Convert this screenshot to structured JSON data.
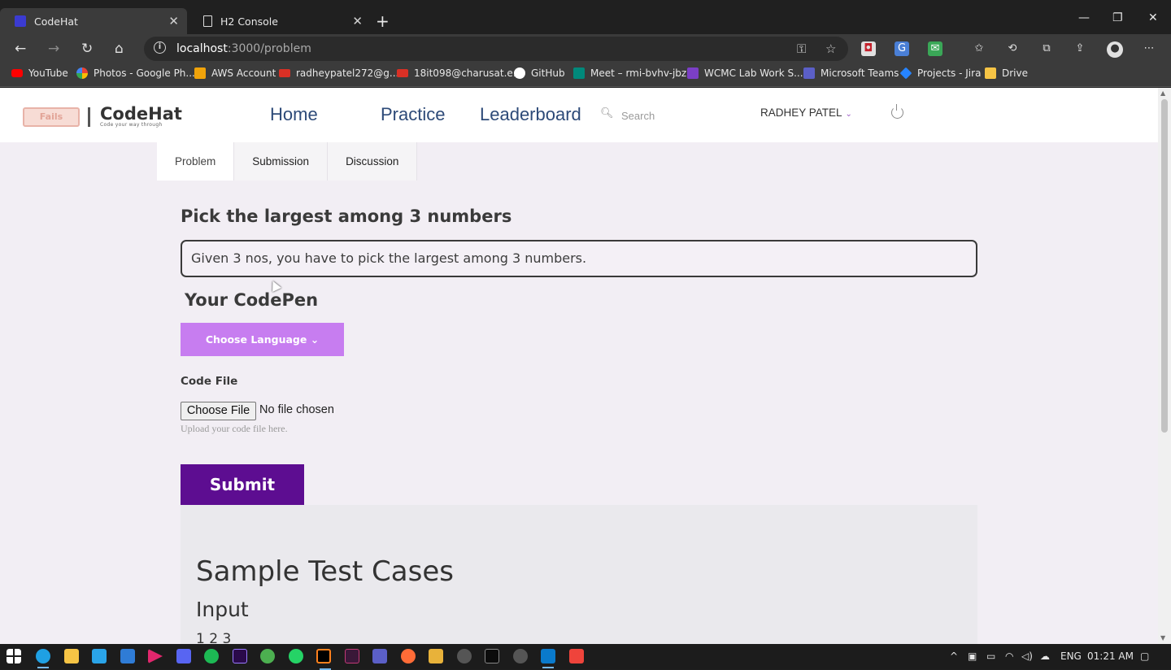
{
  "browser": {
    "tabs": [
      {
        "label": "CodeHat",
        "favicon_color": "#3b3bd1",
        "active": true
      },
      {
        "label": "H2 Console",
        "favicon_icon": "page-icon",
        "active": false
      }
    ],
    "url_host": "localhost",
    "url_path": ":3000/problem",
    "bookmarks": [
      {
        "label": "YouTube",
        "color": "#ff0000"
      },
      {
        "label": "Photos - Google Ph...",
        "color": "#f4b400"
      },
      {
        "label": "AWS Account",
        "color": "#f0a30a"
      },
      {
        "label": "radheypatel272@g...",
        "color": "#d93025"
      },
      {
        "label": "18it098@charusat.e...",
        "color": "#d93025"
      },
      {
        "label": "GitHub",
        "color": "#ffffff"
      },
      {
        "label": "Meet – rmi-bvhv-jbz",
        "color": "#00897b"
      },
      {
        "label": "WCMC Lab Work S...",
        "color": "#7b3fc6"
      },
      {
        "label": "Microsoft Teams",
        "color": "#5b5fc7"
      },
      {
        "label": "Projects - Jira",
        "color": "#2684ff"
      },
      {
        "label": "Drive",
        "color": "#f6c445"
      }
    ]
  },
  "site": {
    "logo_mark": "Fails",
    "logo_name": "CodeHat",
    "logo_tagline": "Code your way through",
    "nav": [
      "Home",
      "Practice",
      "Leaderboard"
    ],
    "search_placeholder": "Search",
    "user_name": "RADHEY PATEL",
    "user_chevron": "⌄"
  },
  "problem_tabs": [
    "Problem",
    "Submission",
    "Discussion"
  ],
  "problem": {
    "title": "Pick the largest among 3 numbers",
    "description": "Given 3 nos, you have to pick the largest among 3 numbers.",
    "codepen_heading": "Your CodePen",
    "choose_language_label": "Choose Language ⌄",
    "code_file_label": "Code File",
    "choose_file_label": "Choose File",
    "file_status": "No file chosen",
    "file_help": "Upload your code file here.",
    "submit_label": "Submit"
  },
  "test_cases": {
    "title": "Sample Test Cases",
    "input_label": "Input",
    "input_value": "1 2 3"
  },
  "taskbar": {
    "language": "ENG",
    "time": "01:21 AM"
  },
  "colors": {
    "accent_purple": "#c77df0",
    "submit_purple": "#5d0d91",
    "nav_blue": "#2d4a78",
    "page_bg": "#f2eef4"
  }
}
